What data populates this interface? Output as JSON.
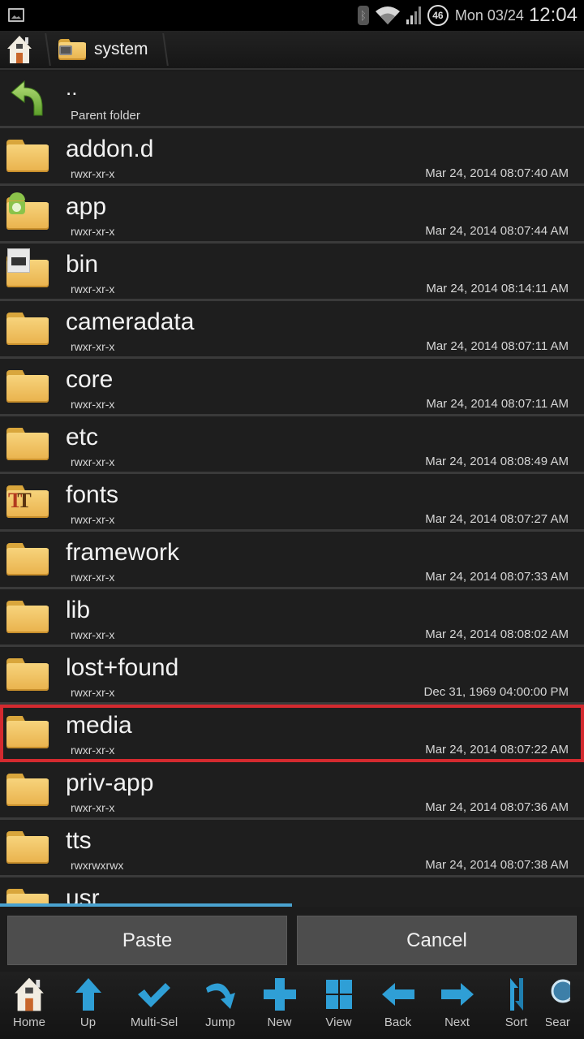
{
  "status_bar": {
    "battery_level": "46",
    "date": "Mon 03/24",
    "time": "12:04",
    "icons": [
      "image-notification-icon",
      "bluetooth-icon",
      "wifi-icon",
      "signal-icon",
      "battery-icon"
    ]
  },
  "breadcrumb": {
    "home_icon": "house-icon",
    "current_folder": "system"
  },
  "parent": {
    "name": "..",
    "label": "Parent folder",
    "icon": "back-arrow-icon"
  },
  "files": [
    {
      "name": "addon.d",
      "perm": "rwxr-xr-x",
      "date": "Mar 24, 2014 08:07:40 AM",
      "icon": "folder"
    },
    {
      "name": "app",
      "perm": "rwxr-xr-x",
      "date": "Mar 24, 2014 08:07:44 AM",
      "icon": "folder-android"
    },
    {
      "name": "bin",
      "perm": "rwxr-xr-x",
      "date": "Mar 24, 2014 08:14:11 AM",
      "icon": "folder-terminal"
    },
    {
      "name": "cameradata",
      "perm": "rwxr-xr-x",
      "date": "Mar 24, 2014 08:07:11 AM",
      "icon": "folder"
    },
    {
      "name": "core",
      "perm": "rwxr-xr-x",
      "date": "Mar 24, 2014 08:07:11 AM",
      "icon": "folder"
    },
    {
      "name": "etc",
      "perm": "rwxr-xr-x",
      "date": "Mar 24, 2014 08:08:49 AM",
      "icon": "folder"
    },
    {
      "name": "fonts",
      "perm": "rwxr-xr-x",
      "date": "Mar 24, 2014 08:07:27 AM",
      "icon": "folder-fonts"
    },
    {
      "name": "framework",
      "perm": "rwxr-xr-x",
      "date": "Mar 24, 2014 08:07:33 AM",
      "icon": "folder"
    },
    {
      "name": "lib",
      "perm": "rwxr-xr-x",
      "date": "Mar 24, 2014 08:08:02 AM",
      "icon": "folder"
    },
    {
      "name": "lost+found",
      "perm": "rwxr-xr-x",
      "date": "Dec 31, 1969 04:00:00 PM",
      "icon": "folder"
    },
    {
      "name": "media",
      "perm": "rwxr-xr-x",
      "date": "Mar 24, 2014 08:07:22 AM",
      "icon": "folder",
      "selected": true
    },
    {
      "name": "priv-app",
      "perm": "rwxr-xr-x",
      "date": "Mar 24, 2014 08:07:36 AM",
      "icon": "folder"
    },
    {
      "name": "tts",
      "perm": "rwxrwxrwx",
      "date": "Mar 24, 2014 08:07:38 AM",
      "icon": "folder"
    },
    {
      "name": "usr",
      "perm": "",
      "date": "",
      "icon": "folder"
    }
  ],
  "progress": {
    "fraction": 0.5
  },
  "actions": {
    "paste": "Paste",
    "cancel": "Cancel"
  },
  "toolbar": [
    {
      "label": "Home",
      "icon": "home-icon"
    },
    {
      "label": "Up",
      "icon": "up-arrow-icon"
    },
    {
      "label": "Multi-Sel",
      "icon": "checkmark-icon"
    },
    {
      "label": "Jump",
      "icon": "jump-arrow-icon"
    },
    {
      "label": "New",
      "icon": "plus-icon"
    },
    {
      "label": "View",
      "icon": "grid-view-icon"
    },
    {
      "label": "Back",
      "icon": "back-arrow-icon"
    },
    {
      "label": "Next",
      "icon": "next-arrow-icon"
    },
    {
      "label": "Sort",
      "icon": "sort-icon"
    },
    {
      "label": "Search",
      "icon": "search-icon"
    }
  ],
  "colors": {
    "accent": "#2f9fd6",
    "selection_outline": "#d42a2f",
    "background": "#1e1e1e",
    "button": "#4d4d4d"
  }
}
